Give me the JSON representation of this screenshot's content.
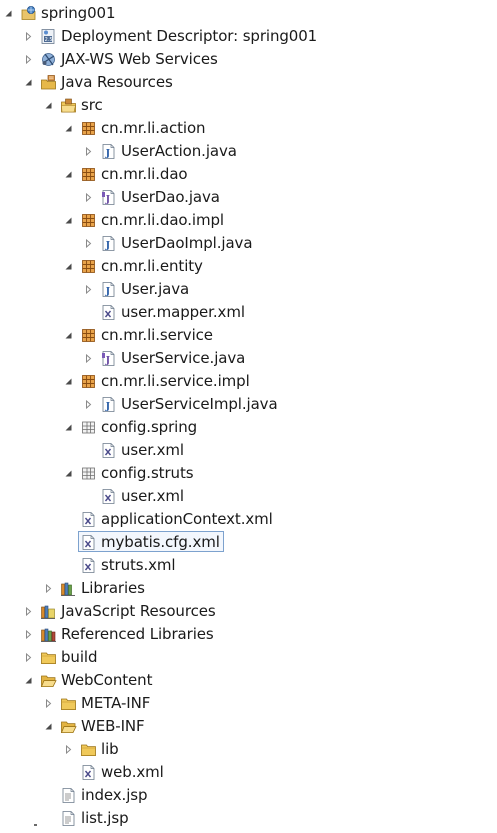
{
  "tree": [
    {
      "label": "spring001",
      "depth": 0,
      "toggle": "expanded",
      "icon": "web-project-icon"
    },
    {
      "label": "Deployment Descriptor: spring001",
      "depth": 1,
      "toggle": "collapsed",
      "icon": "deployment-descriptor-icon"
    },
    {
      "label": "JAX-WS Web Services",
      "depth": 1,
      "toggle": "collapsed",
      "icon": "web-services-icon"
    },
    {
      "label": "Java Resources",
      "depth": 1,
      "toggle": "expanded",
      "icon": "java-resources-icon"
    },
    {
      "label": "src",
      "depth": 2,
      "toggle": "expanded",
      "icon": "source-folder-icon"
    },
    {
      "label": "cn.mr.li.action",
      "depth": 3,
      "toggle": "expanded",
      "icon": "package-icon"
    },
    {
      "label": "UserAction.java",
      "depth": 4,
      "toggle": "collapsed",
      "icon": "java-file-icon"
    },
    {
      "label": "cn.mr.li.dao",
      "depth": 3,
      "toggle": "expanded",
      "icon": "package-icon"
    },
    {
      "label": "UserDao.java",
      "depth": 4,
      "toggle": "collapsed",
      "icon": "java-interface-file-icon"
    },
    {
      "label": "cn.mr.li.dao.impl",
      "depth": 3,
      "toggle": "expanded",
      "icon": "package-icon"
    },
    {
      "label": "UserDaoImpl.java",
      "depth": 4,
      "toggle": "collapsed",
      "icon": "java-file-icon"
    },
    {
      "label": "cn.mr.li.entity",
      "depth": 3,
      "toggle": "expanded",
      "icon": "package-icon"
    },
    {
      "label": "User.java",
      "depth": 4,
      "toggle": "collapsed",
      "icon": "java-file-icon"
    },
    {
      "label": "user.mapper.xml",
      "depth": 4,
      "toggle": "none",
      "icon": "xml-file-icon"
    },
    {
      "label": "cn.mr.li.service",
      "depth": 3,
      "toggle": "expanded",
      "icon": "package-icon"
    },
    {
      "label": "UserService.java",
      "depth": 4,
      "toggle": "collapsed",
      "icon": "java-interface-file-icon"
    },
    {
      "label": "cn.mr.li.service.impl",
      "depth": 3,
      "toggle": "expanded",
      "icon": "package-icon"
    },
    {
      "label": "UserServiceImpl.java",
      "depth": 4,
      "toggle": "collapsed",
      "icon": "java-file-icon"
    },
    {
      "label": "config.spring",
      "depth": 3,
      "toggle": "expanded",
      "icon": "non-java-package-icon"
    },
    {
      "label": "user.xml",
      "depth": 4,
      "toggle": "none",
      "icon": "xml-file-icon"
    },
    {
      "label": "config.struts",
      "depth": 3,
      "toggle": "expanded",
      "icon": "non-java-package-icon"
    },
    {
      "label": "user.xml",
      "depth": 4,
      "toggle": "none",
      "icon": "xml-file-icon"
    },
    {
      "label": "applicationContext.xml",
      "depth": 3,
      "toggle": "none",
      "icon": "xml-file-icon"
    },
    {
      "label": "mybatis.cfg.xml",
      "depth": 3,
      "toggle": "none",
      "icon": "xml-file-icon",
      "selected": true
    },
    {
      "label": "struts.xml",
      "depth": 3,
      "toggle": "none",
      "icon": "xml-file-icon"
    },
    {
      "label": "Libraries",
      "depth": 2,
      "toggle": "collapsed",
      "icon": "libraries-icon"
    },
    {
      "label": "JavaScript Resources",
      "depth": 1,
      "toggle": "collapsed",
      "icon": "javascript-resources-icon"
    },
    {
      "label": "Referenced Libraries",
      "depth": 1,
      "toggle": "collapsed",
      "icon": "referenced-libraries-icon"
    },
    {
      "label": "build",
      "depth": 1,
      "toggle": "collapsed",
      "icon": "folder-icon"
    },
    {
      "label": "WebContent",
      "depth": 1,
      "toggle": "expanded",
      "icon": "open-folder-icon"
    },
    {
      "label": "META-INF",
      "depth": 2,
      "toggle": "collapsed",
      "icon": "folder-icon"
    },
    {
      "label": "WEB-INF",
      "depth": 2,
      "toggle": "expanded",
      "icon": "open-folder-icon"
    },
    {
      "label": "lib",
      "depth": 3,
      "toggle": "collapsed",
      "icon": "folder-icon"
    },
    {
      "label": "web.xml",
      "depth": 3,
      "toggle": "none",
      "icon": "xml-file-icon"
    },
    {
      "label": "index.jsp",
      "depth": 2,
      "toggle": "none",
      "icon": "jsp-file-icon"
    },
    {
      "label": "list.jsp",
      "depth": 2,
      "toggle": "none",
      "icon": "jsp-file-icon"
    }
  ],
  "colors": {
    "selection_border": "#7da2ce",
    "selection_fill": "#f3f7fd",
    "folder": "#e6b84a",
    "package": "#b5651d",
    "java": "#2b5ea7",
    "xml": "#4a4a8a"
  }
}
